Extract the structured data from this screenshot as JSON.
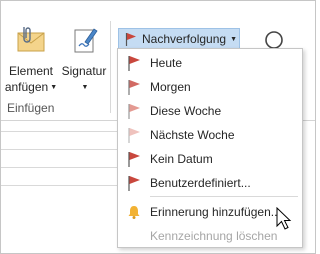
{
  "ribbon": {
    "element_anfuegen": {
      "line1": "Element",
      "line2": "anfügen"
    },
    "signatur": {
      "label": "Signatur"
    },
    "group_label": "Einfügen",
    "nachverfolgung": {
      "label": "Nachverfolgung"
    }
  },
  "menu": {
    "items": [
      {
        "label": "Heute",
        "icon": "flag-icon",
        "color": "#c9473d"
      },
      {
        "label": "Morgen",
        "icon": "flag-icon",
        "color": "#d26a63"
      },
      {
        "label": "Diese Woche",
        "icon": "flag-icon",
        "color": "#e49a92"
      },
      {
        "label": "Nächste Woche",
        "icon": "flag-icon",
        "color": "#efc2bd"
      },
      {
        "label": "Kein Datum",
        "icon": "flag-icon",
        "color": "#c9473d"
      },
      {
        "label": "Benutzerdefiniert...",
        "icon": "flag-icon",
        "color": "#c9473d"
      },
      {
        "label": "Erinnerung hinzufügen...",
        "icon": "bell-icon",
        "color": "#f2b233"
      },
      {
        "label": "Kennzeichnung löschen",
        "icon": "none",
        "color": "#a6a6a6"
      }
    ]
  },
  "colors": {
    "accent_highlight": "#c5dcf3",
    "flag_red": "#c9473d",
    "bell_yellow": "#f2b233"
  }
}
